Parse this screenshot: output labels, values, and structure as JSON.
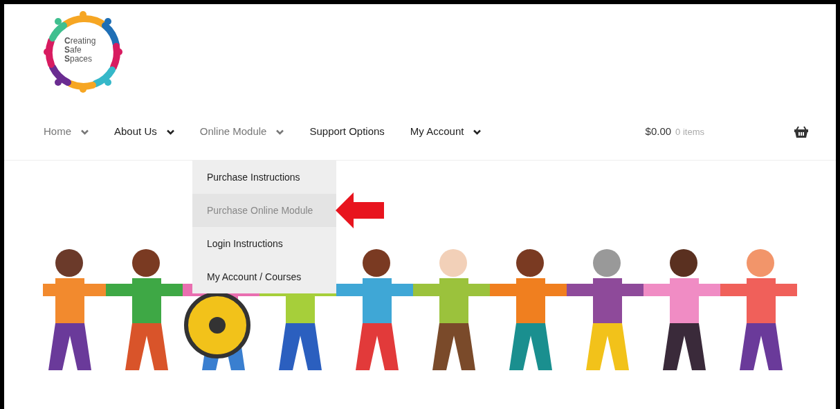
{
  "logo": {
    "lines": [
      "**C**reating",
      "**S**afe",
      "**S**paces"
    ]
  },
  "nav": [
    {
      "label": "Home",
      "selected": true,
      "has_caret": true
    },
    {
      "label": "About Us",
      "selected": false,
      "has_caret": true
    },
    {
      "label": "Online Module",
      "selected": true,
      "has_caret": true,
      "dropdown": [
        {
          "label": "Purchase Instructions",
          "selected": false
        },
        {
          "label": "Purchase Online Module",
          "selected": true
        },
        {
          "label": "Login Instructions",
          "selected": false
        },
        {
          "label": "My Account / Courses",
          "selected": false
        }
      ]
    },
    {
      "label": "Support Options",
      "selected": false,
      "has_caret": false
    },
    {
      "label": "My Account",
      "selected": false,
      "has_caret": true
    }
  ],
  "cart": {
    "total": "$0.00",
    "count": "0 items"
  }
}
